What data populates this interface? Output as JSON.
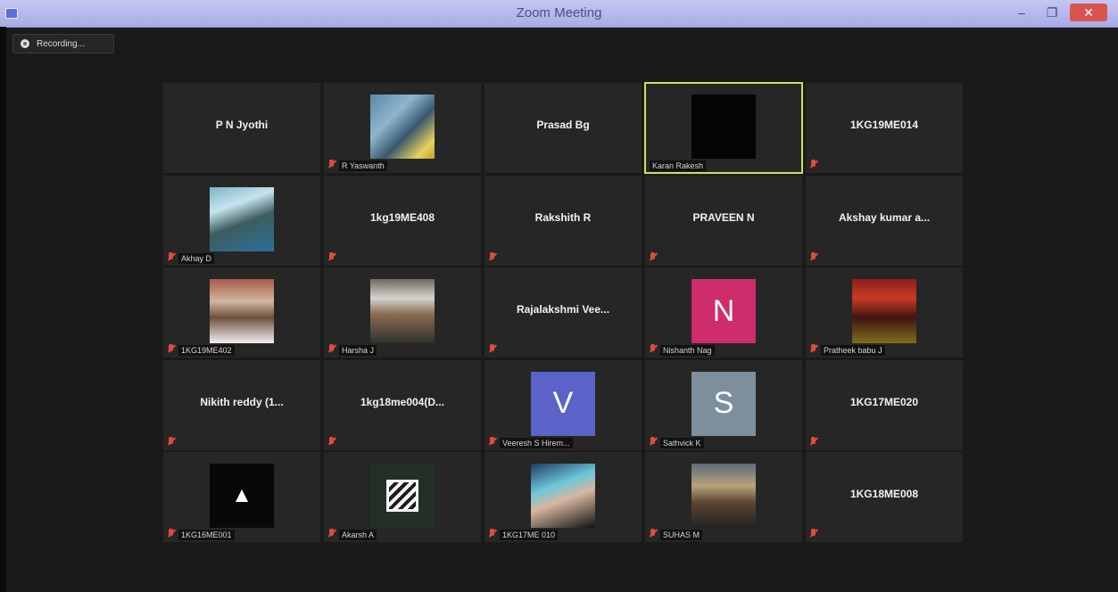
{
  "window": {
    "title": "Zoom Meeting",
    "controls": {
      "minimize": "–",
      "maximize": "❐",
      "close": "✕"
    }
  },
  "recording": {
    "label": "Recording..."
  },
  "participants": [
    {
      "display_name": "P N Jyothi",
      "caption": "",
      "mode": "name",
      "muted": false
    },
    {
      "display_name": "",
      "caption": "R Yaswanth",
      "mode": "photo",
      "style": "person-a",
      "muted": true
    },
    {
      "display_name": "Prasad Bg",
      "caption": "",
      "mode": "name",
      "muted": false
    },
    {
      "display_name": "",
      "caption": "Karan Rakesh",
      "mode": "photo",
      "style": "dark",
      "muted": false,
      "active": true
    },
    {
      "display_name": "1KG19ME014",
      "caption": "",
      "mode": "name",
      "muted": true
    },
    {
      "display_name": "",
      "caption": "Akhay D",
      "mode": "photo",
      "style": "person-b",
      "muted": true
    },
    {
      "display_name": "1kg19ME408",
      "caption": "",
      "mode": "name",
      "muted": true
    },
    {
      "display_name": "Rakshith R",
      "caption": "",
      "mode": "name",
      "muted": true
    },
    {
      "display_name": "PRAVEEN N",
      "caption": "",
      "mode": "name",
      "muted": true
    },
    {
      "display_name": "Akshay kumar a...",
      "caption": "",
      "mode": "name",
      "muted": true
    },
    {
      "display_name": "",
      "caption": "1KG19ME402",
      "mode": "photo",
      "style": "person-c",
      "muted": true
    },
    {
      "display_name": "",
      "caption": "Harsha J",
      "mode": "photo",
      "style": "person-d",
      "muted": true
    },
    {
      "display_name": "Rajalakshmi  Vee...",
      "caption": "",
      "mode": "name",
      "muted": true
    },
    {
      "display_name": "",
      "caption": "Nishanth Nag",
      "mode": "initial",
      "initial": "N",
      "color": "#cf2c6b",
      "muted": true
    },
    {
      "display_name": "",
      "caption": "Pratheek babu J",
      "mode": "photo",
      "style": "person-e",
      "muted": true
    },
    {
      "display_name": "Nikith reddy  (1...",
      "caption": "",
      "mode": "name",
      "muted": true
    },
    {
      "display_name": "1kg18me004(D...",
      "caption": "",
      "mode": "name",
      "muted": true
    },
    {
      "display_name": "",
      "caption": "Veeresh S Hirem...",
      "mode": "initial",
      "initial": "V",
      "color": "#5b62c8",
      "muted": true
    },
    {
      "display_name": "",
      "caption": "Sathvick K",
      "mode": "initial",
      "initial": "S",
      "color": "#7d8f9d",
      "muted": true
    },
    {
      "display_name": "1KG17ME020",
      "caption": "",
      "mode": "name",
      "muted": true
    },
    {
      "display_name": "",
      "caption": "1KG16ME001",
      "mode": "photo",
      "style": "black-logo",
      "logo": "▲",
      "muted": true
    },
    {
      "display_name": "",
      "caption": "Akarsh A",
      "mode": "photo",
      "style": "striped",
      "muted": true
    },
    {
      "display_name": "",
      "caption": "1KG17ME 010",
      "mode": "photo",
      "style": "person-f",
      "muted": true
    },
    {
      "display_name": "",
      "caption": "SUHAS M",
      "mode": "photo",
      "style": "person-g",
      "muted": true
    },
    {
      "display_name": "1KG18ME008",
      "caption": "",
      "mode": "name",
      "muted": true
    }
  ]
}
